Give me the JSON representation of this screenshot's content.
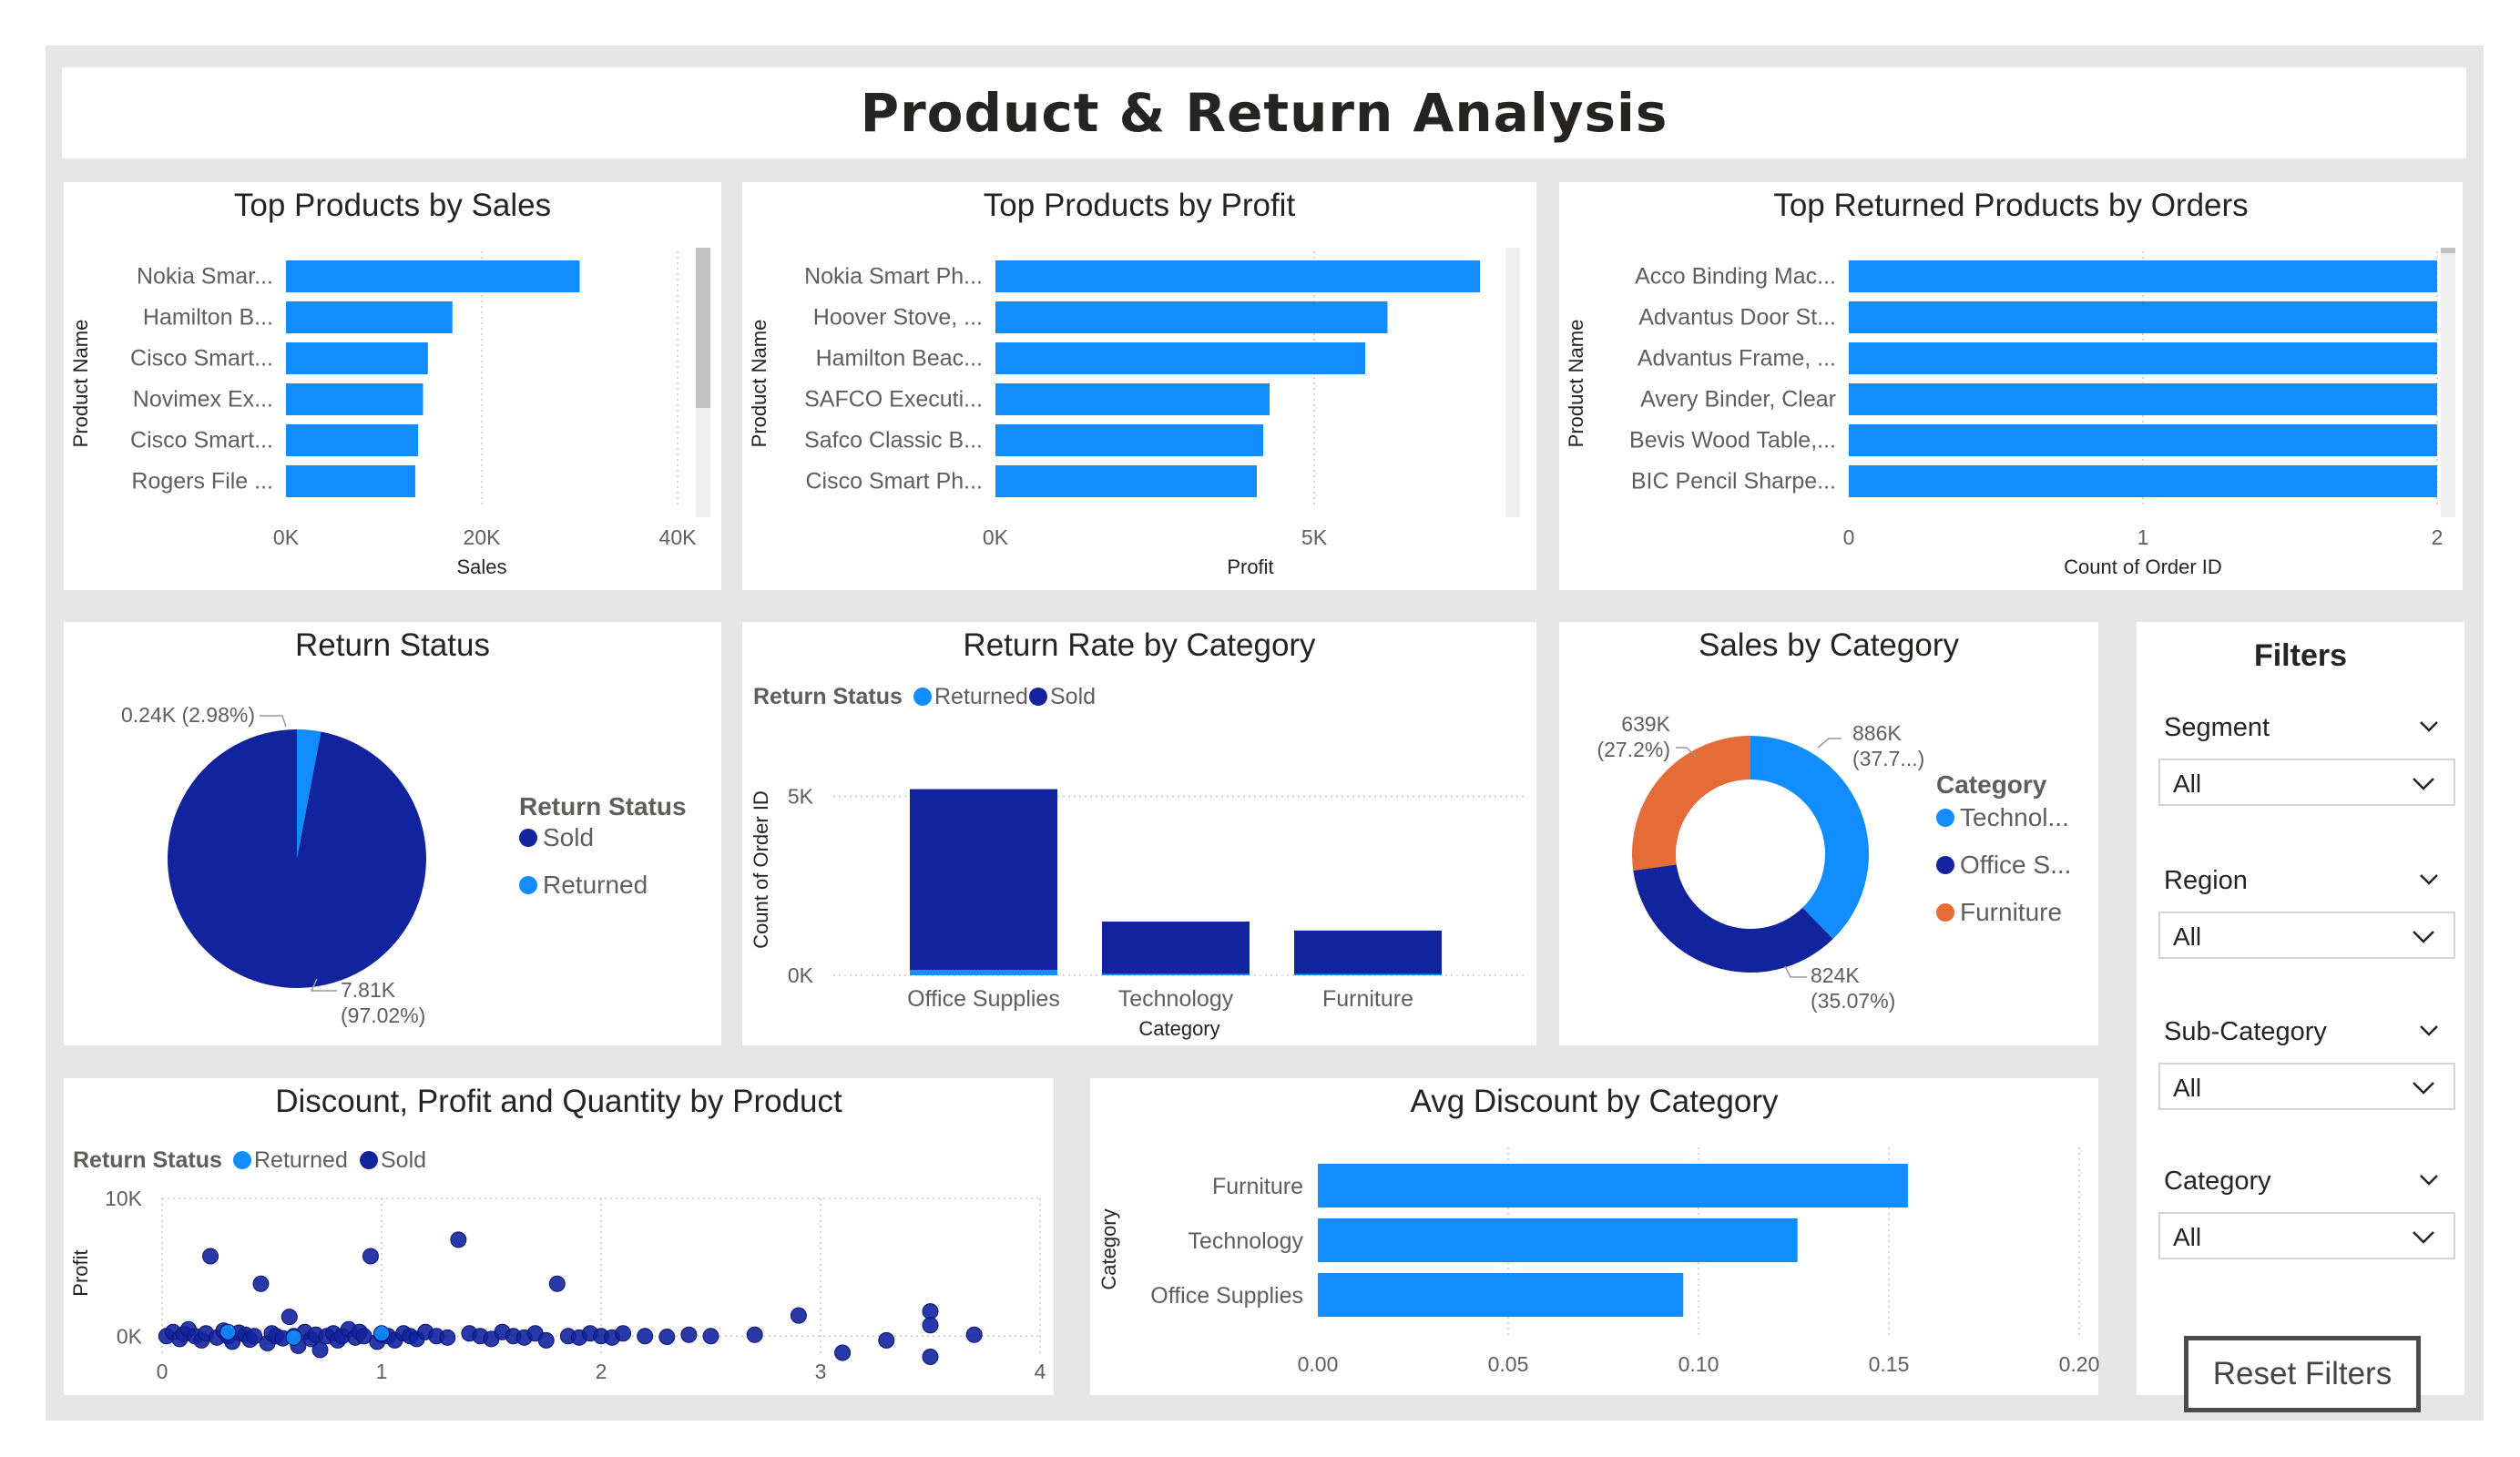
{
  "report": {
    "title": "Product & Return Analysis"
  },
  "colors": {
    "primary": "#118DFF",
    "dark": "#12239E",
    "orange": "#E66C37",
    "background": "#E6E6E6"
  },
  "visuals": {
    "top_sales": {
      "title": "Top Products by Sales",
      "chart_data": {
        "type": "bar",
        "orientation": "horizontal",
        "categories": [
          "Nokia Smar...",
          "Hamilton B...",
          "Cisco Smart...",
          "Novimex Ex...",
          "Cisco Smart...",
          "Rogers File ..."
        ],
        "values": [
          30000,
          17000,
          14500,
          14000,
          13500,
          13200
        ],
        "xlabel": "Sales",
        "ylabel": "Product Name",
        "xlim": [
          0,
          40000
        ],
        "x_ticks": [
          "0K",
          "20K",
          "40K"
        ],
        "grid": true
      }
    },
    "top_profit": {
      "title": "Top Products by Profit",
      "chart_data": {
        "type": "bar",
        "orientation": "horizontal",
        "categories": [
          "Nokia Smart Ph...",
          "Hoover Stove, ...",
          "Hamilton Beac...",
          "SAFCO Executi...",
          "Safco Classic B...",
          "Cisco Smart Ph..."
        ],
        "values": [
          7600,
          6150,
          5800,
          4300,
          4200,
          4100
        ],
        "xlabel": "Profit",
        "ylabel": "Product Name",
        "xlim": [
          0,
          8000
        ],
        "x_ticks": [
          "0K",
          "5K"
        ],
        "grid": true
      }
    },
    "top_returned": {
      "title": "Top Returned Products by Orders",
      "chart_data": {
        "type": "bar",
        "orientation": "horizontal",
        "categories": [
          "Acco Binding Mac...",
          "Advantus Door St...",
          "Advantus Frame, ...",
          "Avery Binder, Clear",
          "Bevis Wood Table,...",
          "BIC Pencil Sharpe..."
        ],
        "values": [
          2,
          2,
          2,
          2,
          2,
          2
        ],
        "xlabel": "Count of Order ID",
        "ylabel": "Product Name",
        "xlim": [
          0,
          2
        ],
        "x_ticks": [
          "0",
          "1",
          "2"
        ],
        "grid": true
      }
    },
    "return_status": {
      "title": "Return Status",
      "chart_data": {
        "type": "pie",
        "labels": [
          "Sold",
          "Returned"
        ],
        "values": [
          7810,
          240
        ],
        "percents": [
          97.02,
          2.98
        ],
        "data_labels": [
          [
            "7.81K",
            "(97.02%)"
          ],
          [
            "0.24K (2.98%)"
          ]
        ],
        "legend_title": "Return Status",
        "legend_items": [
          "Sold",
          "Returned"
        ],
        "legend_position": "right"
      }
    },
    "return_rate": {
      "title": "Return Rate by Category",
      "chart_data": {
        "type": "bar",
        "stacked": true,
        "categories": [
          "Office Supplies",
          "Technology",
          "Furniture"
        ],
        "series": [
          {
            "name": "Returned",
            "values": [
              150,
              40,
              35
            ]
          },
          {
            "name": "Sold",
            "values": [
              5050,
              1460,
              1215
            ]
          }
        ],
        "legend_title": "Return Status",
        "legend_items": [
          "Returned",
          "Sold"
        ],
        "legend_position": "top-left",
        "xlabel": "Category",
        "ylabel": "Count of Order ID",
        "ylim": [
          0,
          5800
        ],
        "y_ticks": [
          "0K",
          "5K"
        ],
        "grid": true
      }
    },
    "sales_category": {
      "title": "Sales by Category",
      "chart_data": {
        "type": "pie",
        "donut": true,
        "labels": [
          "Technology",
          "Office Supplies",
          "Furniture"
        ],
        "values": [
          886,
          824,
          639
        ],
        "percents": [
          37.7,
          35.07,
          27.2
        ],
        "data_labels": [
          [
            "886K",
            "(37.7...)"
          ],
          [
            "824K",
            "(35.07%)"
          ],
          [
            "639K",
            "(27.2%)"
          ]
        ],
        "legend_title": "Category",
        "legend_items": [
          "Technol...",
          "Office S...",
          "Furniture"
        ],
        "legend_position": "right"
      }
    },
    "scatter": {
      "title": "Discount, Profit and Quantity by Product",
      "chart_data": {
        "type": "scatter",
        "legend_title": "Return Status",
        "legend_items": [
          "Returned",
          "Sold"
        ],
        "legend_position": "top-left",
        "x_ticks": [
          "0",
          "1",
          "2",
          "3",
          "4"
        ],
        "y_ticks": [
          "10K",
          "0K"
        ],
        "xlim": [
          0,
          4
        ],
        "ylim": [
          -1500,
          10000
        ],
        "xlabel": "",
        "ylabel": "Profit",
        "series": [
          {
            "name": "Sold",
            "points": [
              [
                0.02,
                0
              ],
              [
                0.05,
                300
              ],
              [
                0.08,
                -200
              ],
              [
                0.1,
                150
              ],
              [
                0.12,
                500
              ],
              [
                0.15,
                0
              ],
              [
                0.18,
                -300
              ],
              [
                0.2,
                200
              ],
              [
                0.22,
                5800
              ],
              [
                0.25,
                -100
              ],
              [
                0.28,
                400
              ],
              [
                0.3,
                0
              ],
              [
                0.32,
                -400
              ],
              [
                0.35,
                250
              ],
              [
                0.38,
                100
              ],
              [
                0.4,
                -250
              ],
              [
                0.42,
                0
              ],
              [
                0.45,
                3800
              ],
              [
                0.48,
                -500
              ],
              [
                0.5,
                200
              ],
              [
                0.52,
                0
              ],
              [
                0.55,
                -150
              ],
              [
                0.58,
                1400
              ],
              [
                0.6,
                0
              ],
              [
                0.62,
                -700
              ],
              [
                0.65,
                300
              ],
              [
                0.68,
                -200
              ],
              [
                0.7,
                100
              ],
              [
                0.72,
                -1000
              ],
              [
                0.75,
                0
              ],
              [
                0.78,
                200
              ],
              [
                0.8,
                -300
              ],
              [
                0.82,
                0
              ],
              [
                0.85,
                500
              ],
              [
                0.88,
                -100
              ],
              [
                0.9,
                300
              ],
              [
                0.92,
                0
              ],
              [
                0.95,
                5800
              ],
              [
                0.98,
                -400
              ],
              [
                1.0,
                100
              ],
              [
                1.03,
                0
              ],
              [
                1.06,
                -300
              ],
              [
                1.1,
                200
              ],
              [
                1.13,
                0
              ],
              [
                1.16,
                -200
              ],
              [
                1.2,
                300
              ],
              [
                1.25,
                0
              ],
              [
                1.3,
                -100
              ],
              [
                1.35,
                7000
              ],
              [
                1.4,
                200
              ],
              [
                1.45,
                0
              ],
              [
                1.5,
                -200
              ],
              [
                1.55,
                300
              ],
              [
                1.6,
                0
              ],
              [
                1.65,
                -100
              ],
              [
                1.7,
                200
              ],
              [
                1.75,
                -300
              ],
              [
                1.8,
                3800
              ],
              [
                1.85,
                0
              ],
              [
                1.9,
                -100
              ],
              [
                1.95,
                200
              ],
              [
                2.0,
                0
              ],
              [
                2.05,
                -100
              ],
              [
                2.1,
                200
              ],
              [
                2.2,
                0
              ],
              [
                2.3,
                -50
              ],
              [
                2.4,
                100
              ],
              [
                2.5,
                0
              ],
              [
                2.7,
                100
              ],
              [
                2.9,
                1500
              ],
              [
                3.1,
                -1200
              ],
              [
                3.3,
                -300
              ],
              [
                3.5,
                -1500
              ],
              [
                3.5,
                1800
              ],
              [
                3.5,
                800
              ],
              [
                3.7,
                100
              ]
            ]
          },
          {
            "name": "Returned",
            "points": [
              [
                0.3,
                300
              ],
              [
                0.6,
                -100
              ],
              [
                1.0,
                200
              ]
            ]
          }
        ]
      }
    },
    "avg_discount": {
      "title": "Avg Discount by Category",
      "chart_data": {
        "type": "bar",
        "orientation": "horizontal",
        "categories": [
          "Furniture",
          "Technology",
          "Office Supplies"
        ],
        "values": [
          0.155,
          0.126,
          0.096
        ],
        "xlabel": "",
        "ylabel": "Category",
        "xlim": [
          0,
          0.2
        ],
        "x_ticks": [
          "0.00",
          "0.05",
          "0.10",
          "0.15",
          "0.20"
        ],
        "grid": true
      }
    }
  },
  "filters": {
    "title": "Filters",
    "slicers": [
      {
        "label": "Segment",
        "value": "All"
      },
      {
        "label": "Region",
        "value": "All"
      },
      {
        "label": "Sub-Category",
        "value": "All"
      },
      {
        "label": "Category",
        "value": "All"
      }
    ],
    "reset_label": "Reset Filters"
  }
}
